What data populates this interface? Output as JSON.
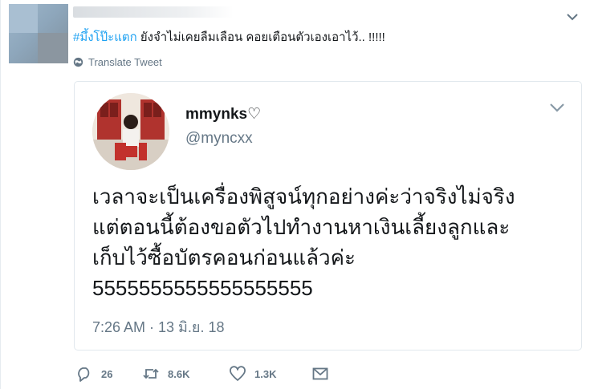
{
  "tweet": {
    "hashtag": "#มึ้งโป๊ะแตก",
    "text": " ยังจำไม่เคยลืมเลือน คอยเตือนตัวเองเอาไว้.. !!!!!",
    "translate_label": "Translate Tweet"
  },
  "quoted_tweet": {
    "name": "mmynks♡",
    "handle": "@myncxx",
    "body_lines": [
      "เวลาจะเป็นเครื่องพิสูจน์ทุกอย่างค่ะว่าจริงไม่จริง",
      "แต่ตอนนี้ต้องขอตัวไปทำงานหาเงินเลี้ยงลูกและ",
      "เก็บไว้ซื้อบัตรคอนก่อนแล้วค่ะ",
      "5555555555555555555"
    ],
    "timestamp": "7:26 AM · 13 มิ.ย. 18"
  },
  "actions": {
    "reply_count": "26",
    "retweet_count": "8.6K",
    "like_count": "1.3K"
  },
  "icons": [
    "globe-icon",
    "chevron-down-icon",
    "reply-icon",
    "retweet-icon",
    "like-icon",
    "message-icon"
  ],
  "colors": {
    "accent": "#1da1f2",
    "secondary_text": "#657786",
    "border": "#e1e8ed"
  }
}
